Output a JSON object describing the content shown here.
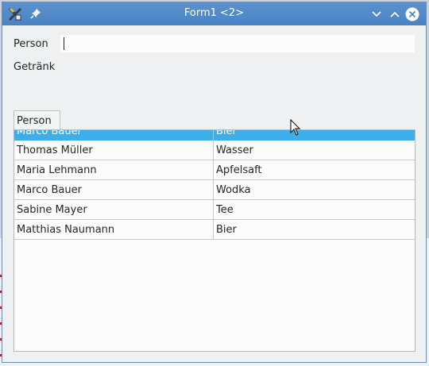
{
  "window": {
    "title": "Form1 <2>",
    "icons": {
      "app": "kde-app-icon",
      "pin": "pin-icon",
      "minimize": "chevron-down-icon",
      "maximize": "chevron-up-icon",
      "close": "close-icon"
    }
  },
  "form": {
    "person_label": "Person",
    "drink_label": "Getränk",
    "person_value": ""
  },
  "table": {
    "header": "Person",
    "selected_row": {
      "person": "Marco Bauer",
      "drink": "Bier"
    },
    "rows": [
      {
        "person": "Thomas Müller",
        "drink": "Wasser"
      },
      {
        "person": "Maria Lehmann",
        "drink": "Apfelsaft"
      },
      {
        "person": "Marco Bauer",
        "drink": "Wodka"
      },
      {
        "person": "Sabine Mayer",
        "drink": "Tee"
      },
      {
        "person": "Matthias Naumann",
        "drink": "Bier"
      }
    ]
  },
  "colors": {
    "titlebar": "#4a83c4",
    "selection": "#3daee9",
    "window_bg": "#eff0f1"
  }
}
